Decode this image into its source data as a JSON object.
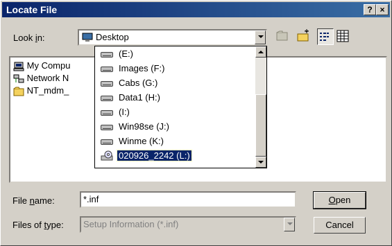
{
  "window": {
    "title": "Locate File",
    "help_label": "?",
    "close_label": "×"
  },
  "lookin": {
    "label_pre": "Look ",
    "label_key": "i",
    "label_post": "n:",
    "value": "Desktop"
  },
  "file_list": [
    {
      "label": "My Compu",
      "icon": "computer-icon"
    },
    {
      "label": "Network N",
      "icon": "network-icon"
    },
    {
      "label": "NT_mdm_",
      "icon": "folder-icon"
    }
  ],
  "dropdown_items": [
    {
      "label": "(E:)",
      "icon": "drive-icon",
      "selected": false
    },
    {
      "label": "Images (F:)",
      "icon": "drive-icon",
      "selected": false
    },
    {
      "label": "Cabs (G:)",
      "icon": "drive-icon",
      "selected": false
    },
    {
      "label": "Data1 (H:)",
      "icon": "drive-icon",
      "selected": false
    },
    {
      "label": "(I:)",
      "icon": "drive-icon",
      "selected": false
    },
    {
      "label": "Win98se (J:)",
      "icon": "drive-icon",
      "selected": false
    },
    {
      "label": "Winme (K:)",
      "icon": "drive-icon",
      "selected": false
    },
    {
      "label": "020926_2242 (L:)",
      "icon": "cdrom-icon",
      "selected": true
    }
  ],
  "filename": {
    "label_pre": "File ",
    "label_key": "n",
    "label_post": "ame:",
    "value": "*.inf"
  },
  "filetype": {
    "label_pre": "Files of ",
    "label_key": "t",
    "label_post": "ype:",
    "value": "Setup Information (*.inf)"
  },
  "buttons": {
    "open_key": "O",
    "open_rest": "pen",
    "cancel": "Cancel"
  }
}
